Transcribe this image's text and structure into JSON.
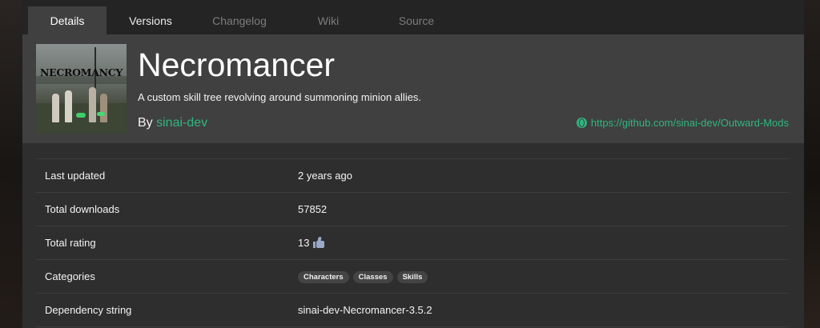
{
  "tabs": [
    {
      "label": "Details",
      "state": "active"
    },
    {
      "label": "Versions",
      "state": "enabled"
    },
    {
      "label": "Changelog",
      "state": "disabled"
    },
    {
      "label": "Wiki",
      "state": "disabled"
    },
    {
      "label": "Source",
      "state": "disabled"
    }
  ],
  "mod": {
    "thumbnail_text": "NECROMANCY",
    "title": "Necromancer",
    "description": "A custom skill tree revolving around summoning minion allies.",
    "by_prefix": "By",
    "author": "sinai-dev",
    "website": "https://github.com/sinai-dev/Outward-Mods",
    "website_icon": "globe-icon"
  },
  "details": {
    "last_updated": {
      "label": "Last updated",
      "value": "2 years ago"
    },
    "total_downloads": {
      "label": "Total downloads",
      "value": "57852"
    },
    "total_rating": {
      "label": "Total rating",
      "value": "13",
      "icon": "thumbs-up-icon"
    },
    "categories": {
      "label": "Categories",
      "values": [
        "Characters",
        "Classes",
        "Skills"
      ]
    },
    "dependency_string": {
      "label": "Dependency string",
      "value": "sinai-dev-Necromancer-3.5.2"
    }
  },
  "colors": {
    "accent": "#2fb67e",
    "panel": "#2e2e2e",
    "header": "#404040",
    "tabbar": "#242424"
  }
}
